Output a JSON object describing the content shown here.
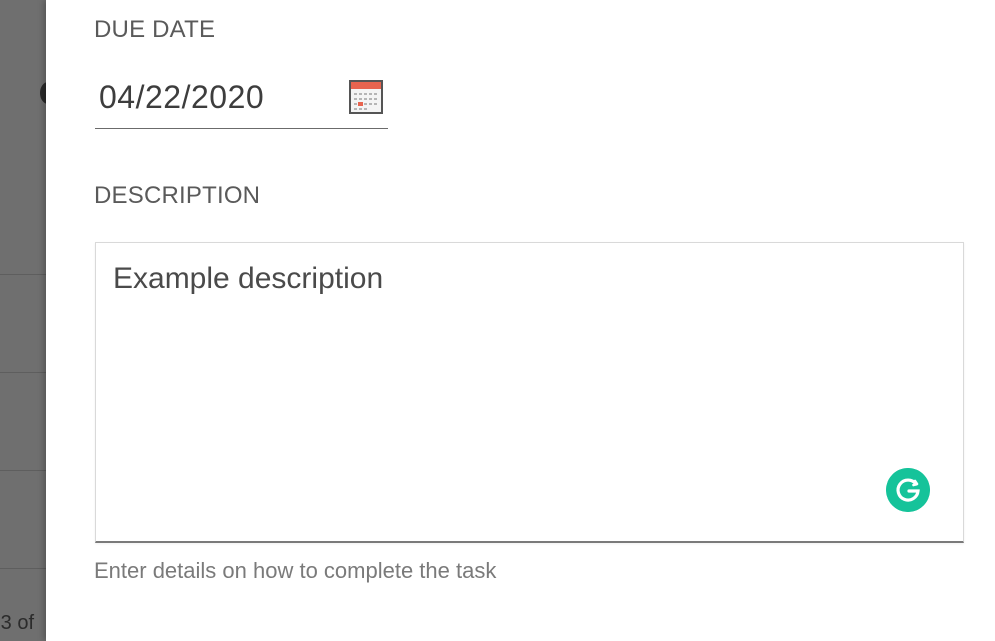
{
  "background": {
    "pager_text": "-3 of"
  },
  "due_date": {
    "label": "DUE DATE",
    "value": "04/22/2020",
    "icon": "calendar-icon"
  },
  "description": {
    "label": "DESCRIPTION",
    "value": "Example description",
    "hint": "Enter details on how to complete the task",
    "assistant_icon": "grammarly-icon"
  },
  "colors": {
    "drawer_bg": "#ffffff",
    "backdrop": "#6f6f6f",
    "grammarly": "#15c39a",
    "calendar_header": "#e8644f"
  }
}
